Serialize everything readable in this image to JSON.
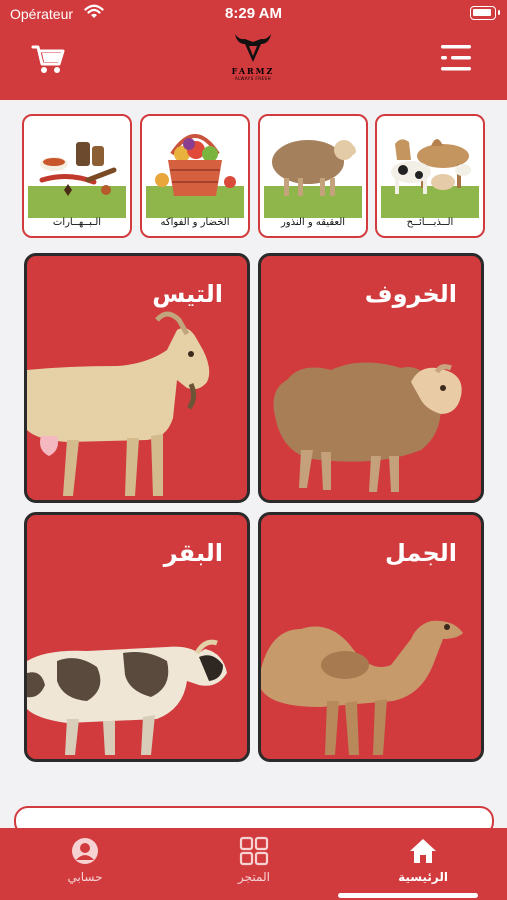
{
  "status_bar": {
    "carrier": "Opérateur",
    "time": "8:29 AM"
  },
  "header": {
    "brand": "FARMZ",
    "tagline": "ALWAYS FRESH",
    "cart_icon": "cart-icon",
    "menu_icon": "menu-icon"
  },
  "categories": [
    {
      "label": "الــذبـــائــح"
    },
    {
      "label": "العقيقه و النذور"
    },
    {
      "label": "الخضار و الفواكه"
    },
    {
      "label": "الـبــهــارات"
    }
  ],
  "animals": [
    {
      "label": "الخروف"
    },
    {
      "label": "التيس"
    },
    {
      "label": "الجمل"
    },
    {
      "label": "البقر"
    }
  ],
  "tabs": [
    {
      "label": "الرئيسية",
      "icon": "home-icon",
      "active": true
    },
    {
      "label": "المتجر",
      "icon": "grid-icon",
      "active": false
    },
    {
      "label": "حسابي",
      "icon": "account-icon",
      "active": false
    }
  ],
  "colors": {
    "primary": "#d23b3e",
    "background": "#f2f2f4"
  }
}
